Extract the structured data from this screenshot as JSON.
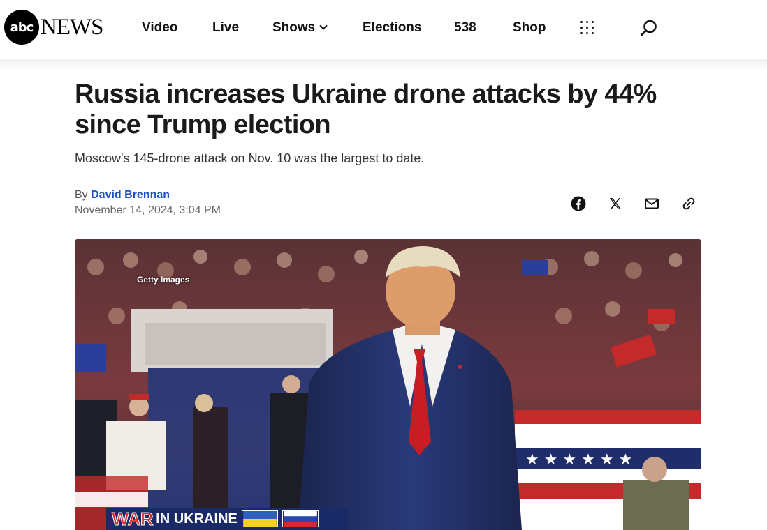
{
  "header": {
    "logo_badge": "abc",
    "logo_word": "NEWS",
    "nav": [
      {
        "label": "Video"
      },
      {
        "label": "Live"
      },
      {
        "label": "Shows"
      },
      {
        "label": "Elections"
      },
      {
        "label": "538"
      },
      {
        "label": "Shop"
      }
    ]
  },
  "article": {
    "headline": "Russia increases Ukraine drone attacks by 44% since Trump election",
    "dek": "Moscow's 145-drone attack on Nov. 10 was the largest to date.",
    "byline_prefix": "By",
    "author": "David Brennan",
    "date": "November 14, 2024, 3:04 PM"
  },
  "share": [
    "facebook-icon",
    "x-icon",
    "mail-icon",
    "link-icon"
  ],
  "image": {
    "credit": "Getty Images",
    "banner_main": "WAR",
    "banner_sub": "IN UKRAINE"
  },
  "colors": {
    "link": "#1d52c4",
    "banner_red": "#d92c2c",
    "banner_navy": "#1a2a66"
  }
}
